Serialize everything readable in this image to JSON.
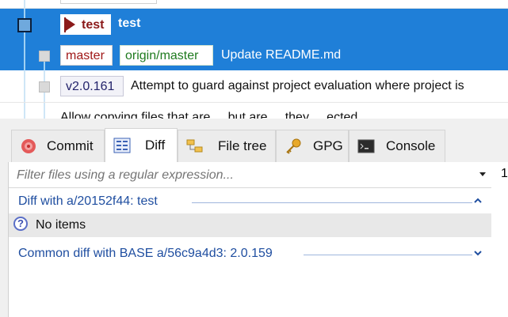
{
  "graph": {
    "rows": [
      {
        "tag": "test",
        "message": "test",
        "selected": true
      },
      {
        "branches": [
          "master",
          "origin/master"
        ],
        "message": "Update README.md",
        "selected": true
      },
      {
        "tag": "v2.0.161",
        "message": "Attempt to guard against project evaluation where project is"
      },
      {
        "message": "Allow copying files that are ... but are ... they ... ected ..."
      }
    ]
  },
  "tabs": [
    {
      "label": "Commit",
      "icon": "commit-icon"
    },
    {
      "label": "Diff",
      "icon": "diff-icon",
      "active": true
    },
    {
      "label": "File tree",
      "icon": "file-tree-icon"
    },
    {
      "label": "GPG",
      "icon": "key-icon"
    },
    {
      "label": "Console",
      "icon": "console-icon"
    }
  ],
  "filter": {
    "placeholder": "Filter files using a regular expression..."
  },
  "diffs": [
    {
      "title": "Diff with a/20152f44: test",
      "expanded": true
    },
    {
      "title": "Common diff with BASE a/56c9a4d3: 2.0.159",
      "expanded": false
    }
  ],
  "no_items": "No items",
  "right_pane_value": "1"
}
